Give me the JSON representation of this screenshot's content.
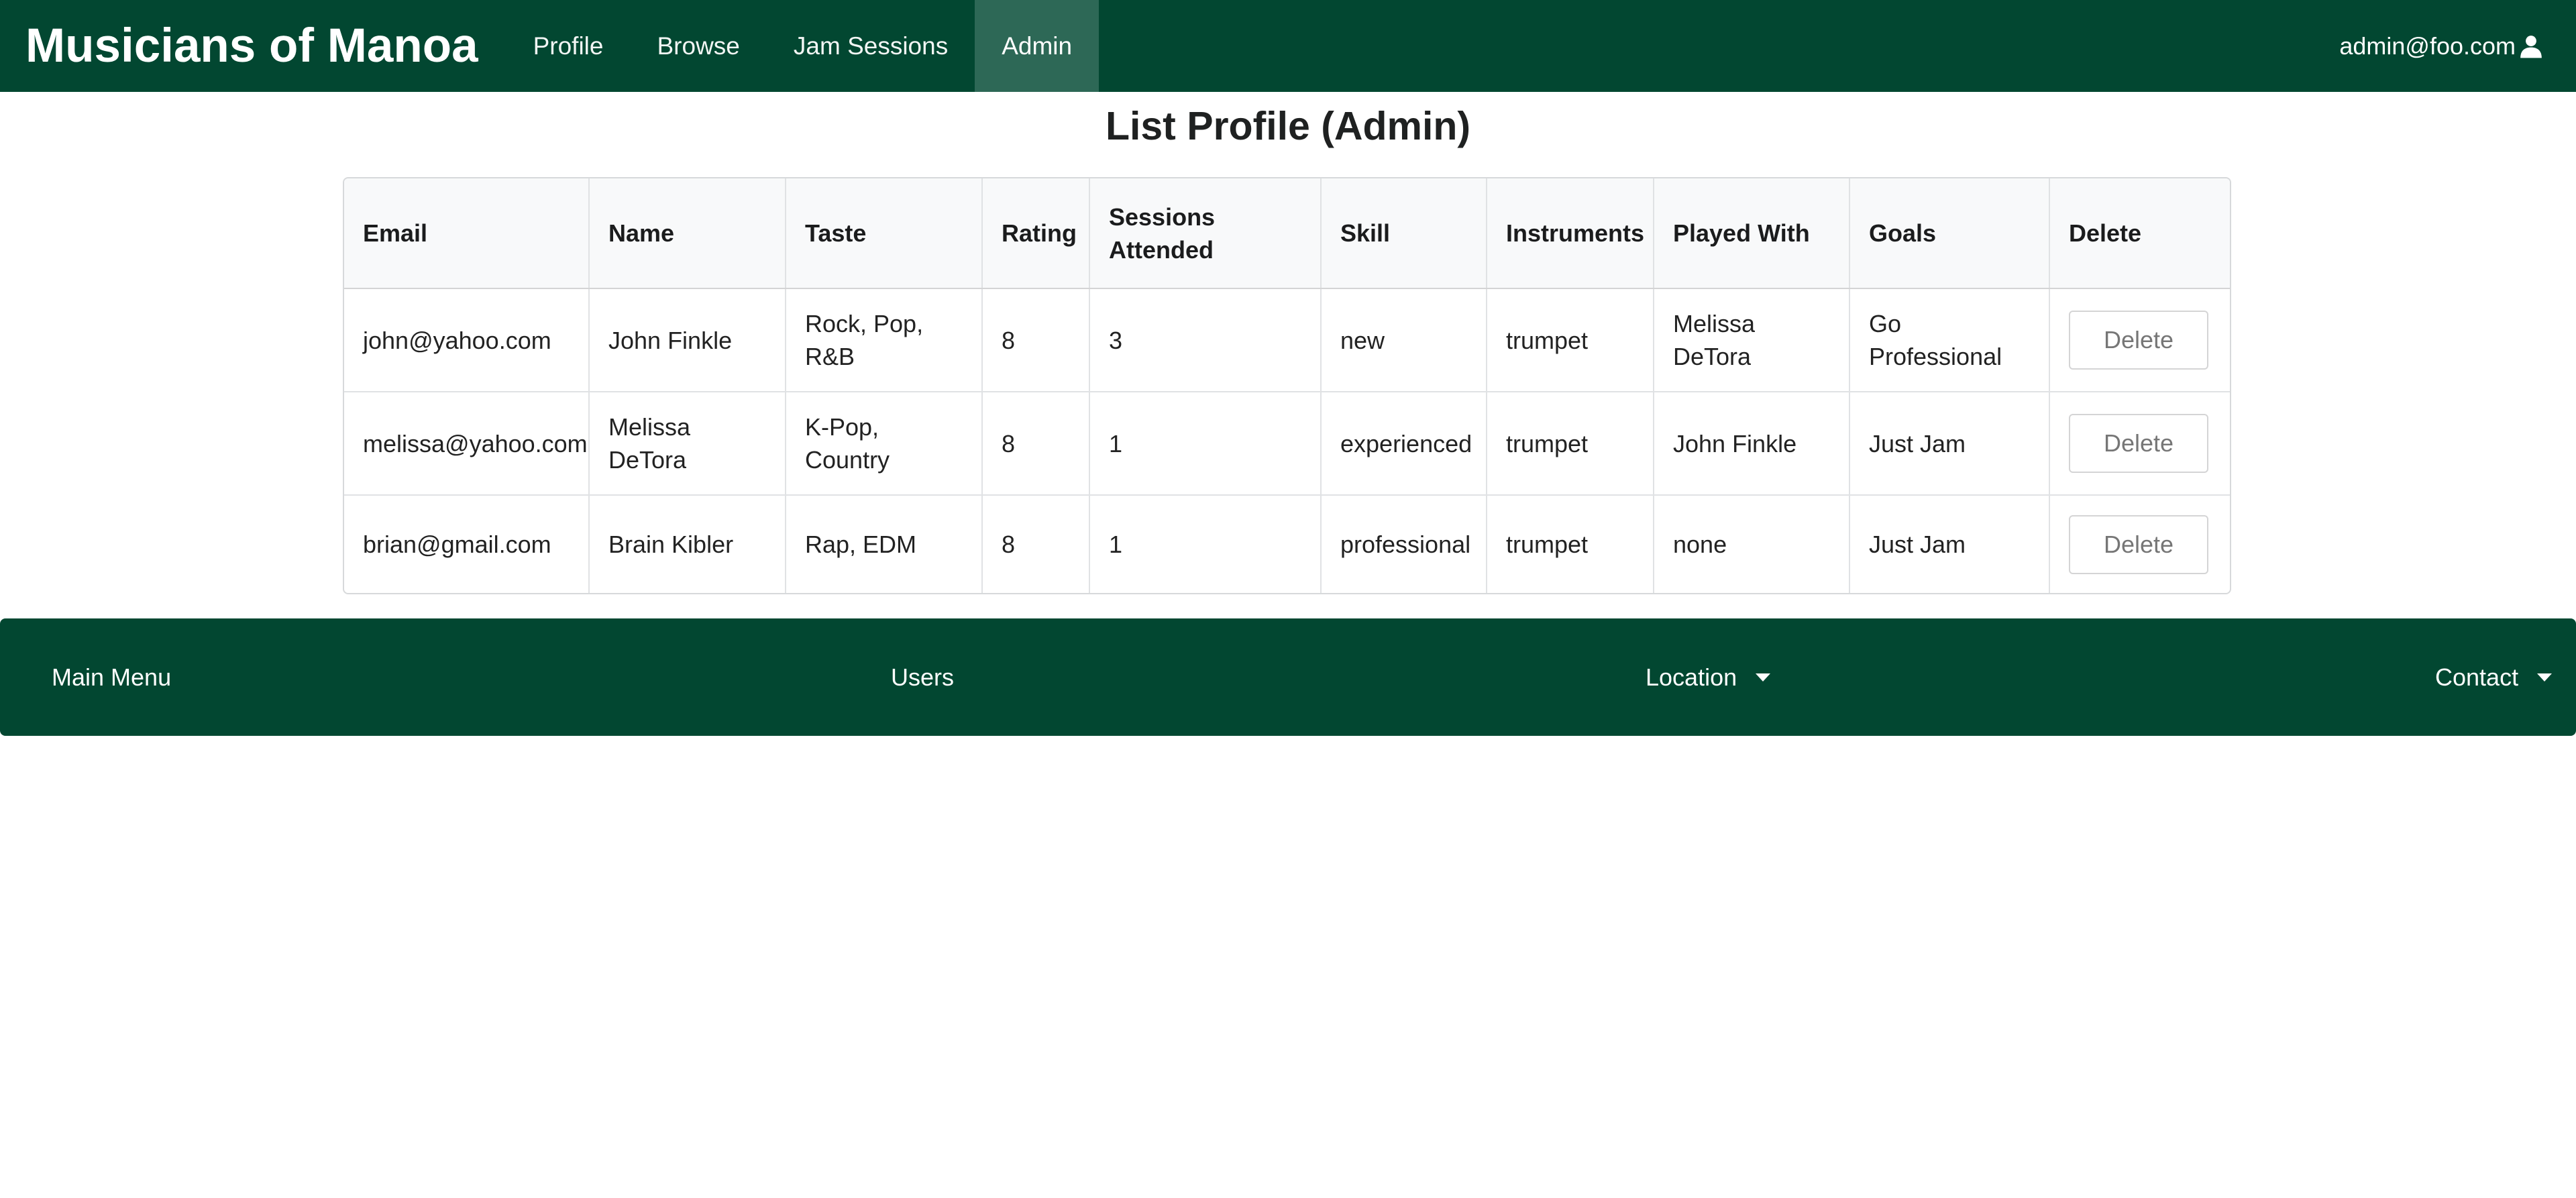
{
  "navbar": {
    "brand": "Musicians of Manoa",
    "items": [
      {
        "label": "Profile",
        "active": false
      },
      {
        "label": "Browse",
        "active": false
      },
      {
        "label": "Jam Sessions",
        "active": false
      },
      {
        "label": "Admin",
        "active": true
      }
    ],
    "user_email": "admin@foo.com",
    "user_icon": "user-icon"
  },
  "page": {
    "title": "List Profile (Admin)"
  },
  "table": {
    "headers": [
      "Email",
      "Name",
      "Taste",
      "Rating",
      "Sessions Attended",
      "Skill",
      "Instruments",
      "Played With",
      "Goals",
      "Delete"
    ],
    "rows": [
      {
        "email": "john@yahoo.com",
        "name": "John Finkle",
        "taste": "Rock, Pop, R&B",
        "rating": "8",
        "sessions": "3",
        "skill": "new",
        "instruments": "trumpet",
        "played_with": "Melissa DeTora",
        "goals": "Go Professional",
        "delete_label": "Delete"
      },
      {
        "email": "melissa@yahoo.com",
        "name": "Melissa DeTora",
        "taste": "K-Pop, Country",
        "rating": "8",
        "sessions": "1",
        "skill": "experienced",
        "instruments": "trumpet",
        "played_with": "John Finkle",
        "goals": "Just Jam",
        "delete_label": "Delete"
      },
      {
        "email": "brian@gmail.com",
        "name": "Brain Kibler",
        "taste": "Rap, EDM",
        "rating": "8",
        "sessions": "1",
        "skill": "professional",
        "instruments": "trumpet",
        "played_with": "none",
        "goals": "Just Jam",
        "delete_label": "Delete"
      }
    ]
  },
  "footer": {
    "main_menu": "Main Menu",
    "users": "Users",
    "location": "Location",
    "contact": "Contact"
  },
  "colors": {
    "brand_green": "#024731",
    "active_tab": "#2d6856"
  }
}
